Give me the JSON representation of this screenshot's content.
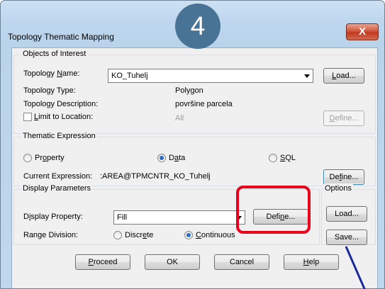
{
  "window": {
    "title": "Topology Thematic Mapping",
    "close_glyph": "X"
  },
  "step_badge": "4",
  "objects_of_interest": {
    "legend": "Objects of Interest",
    "topology_name_label": "Topology Name:",
    "topology_name_value": "KO_Tuhelj",
    "load_label": "Load...",
    "topology_type_label": "Topology Type:",
    "topology_type_value": "Polygon",
    "topology_description_label": "Topology Description:",
    "topology_description_value": "površine parcela",
    "limit_to_location_label": "Limit to Location:",
    "limit_to_location_checked": false,
    "limit_to_location_value": "All",
    "define_label": "Define..."
  },
  "thematic_expression": {
    "legend": "Thematic Expression",
    "options": [
      "Property",
      "Data",
      "SQL"
    ],
    "selected": "Data",
    "current_expression_label": "Current Expression:",
    "current_expression_value": ":AREA@TPMCNTR_KO_Tuhelj",
    "define_label": "Define..."
  },
  "display_parameters": {
    "legend": "Display Parameters",
    "display_property_label": "Display Property:",
    "display_property_value": "Fill",
    "define_label": "Define...",
    "range_division_label": "Range Division:",
    "range_options": [
      "Discrete",
      "Continuous"
    ],
    "range_selected": "Continuous"
  },
  "options": {
    "legend": "Options",
    "load_label": "Load...",
    "save_label": "Save..."
  },
  "footer": {
    "proceed_label": "Proceed",
    "ok_label": "OK",
    "cancel_label": "Cancel",
    "help_label": "Help"
  },
  "annotation_colors": {
    "highlight_box": "#e8001c",
    "pointer_line": "#1a2a9c",
    "badge": "#497394"
  }
}
